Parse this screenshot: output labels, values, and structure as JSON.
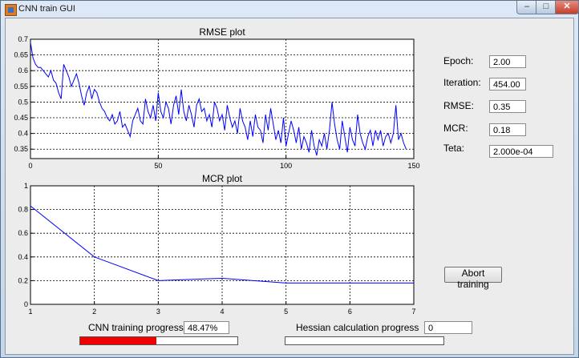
{
  "window": {
    "title": "CNN train GUI",
    "min_label": "–",
    "max_label": "□",
    "close_label": "✕"
  },
  "rmse_plot": {
    "title": "RMSE plot",
    "x_ticks": [
      "0",
      "50",
      "100",
      "150"
    ],
    "y_ticks": [
      "0.35",
      "0.4",
      "0.45",
      "0.5",
      "0.55",
      "0.6",
      "0.65",
      "0.7"
    ]
  },
  "mcr_plot": {
    "title": "MCR plot",
    "x_ticks": [
      "1",
      "2",
      "3",
      "4",
      "5",
      "6",
      "7"
    ],
    "y_ticks": [
      "0",
      "0.2",
      "0.4",
      "0.6",
      "0.8",
      "1"
    ]
  },
  "chart_data": [
    {
      "type": "line",
      "title": "RMSE plot",
      "xlim": [
        0,
        150
      ],
      "ylim": [
        0.32,
        0.7
      ],
      "grid": true,
      "color": "#0000ff",
      "x_step": 1,
      "values": [
        0.69,
        0.64,
        0.62,
        0.61,
        0.61,
        0.6,
        0.59,
        0.58,
        0.6,
        0.57,
        0.56,
        0.53,
        0.51,
        0.62,
        0.6,
        0.58,
        0.55,
        0.57,
        0.59,
        0.56,
        0.52,
        0.49,
        0.53,
        0.55,
        0.51,
        0.54,
        0.53,
        0.5,
        0.48,
        0.47,
        0.45,
        0.44,
        0.46,
        0.43,
        0.44,
        0.47,
        0.42,
        0.43,
        0.41,
        0.39,
        0.44,
        0.46,
        0.48,
        0.44,
        0.43,
        0.51,
        0.47,
        0.45,
        0.49,
        0.44,
        0.53,
        0.47,
        0.45,
        0.5,
        0.48,
        0.43,
        0.49,
        0.52,
        0.46,
        0.54,
        0.47,
        0.44,
        0.49,
        0.46,
        0.42,
        0.49,
        0.51,
        0.47,
        0.48,
        0.44,
        0.46,
        0.42,
        0.5,
        0.48,
        0.44,
        0.46,
        0.41,
        0.49,
        0.45,
        0.42,
        0.44,
        0.4,
        0.48,
        0.44,
        0.42,
        0.38,
        0.44,
        0.39,
        0.46,
        0.42,
        0.41,
        0.37,
        0.46,
        0.41,
        0.48,
        0.43,
        0.38,
        0.41,
        0.37,
        0.45,
        0.36,
        0.4,
        0.44,
        0.41,
        0.37,
        0.42,
        0.35,
        0.39,
        0.37,
        0.34,
        0.41,
        0.36,
        0.33,
        0.38,
        0.36,
        0.4,
        0.35,
        0.41,
        0.5,
        0.43,
        0.38,
        0.35,
        0.44,
        0.39,
        0.34,
        0.42,
        0.38,
        0.36,
        0.46,
        0.4,
        0.37,
        0.35,
        0.39,
        0.41,
        0.36,
        0.41,
        0.38,
        0.41,
        0.36,
        0.39,
        0.4,
        0.37,
        0.4,
        0.49,
        0.38,
        0.4,
        0.37,
        0.35
      ]
    },
    {
      "type": "line",
      "title": "MCR plot",
      "xlim": [
        1,
        7
      ],
      "ylim": [
        0,
        1
      ],
      "grid": true,
      "color": "#0000ff",
      "x": [
        1,
        2,
        3,
        4,
        5,
        6,
        7
      ],
      "values": [
        0.83,
        0.4,
        0.2,
        0.22,
        0.18,
        0.18,
        0.18
      ]
    }
  ],
  "stats": {
    "epoch_label": "Epoch:",
    "epoch_value": "2.00",
    "iteration_label": "Iteration:",
    "iteration_value": "454.00",
    "rmse_label": "RMSE:",
    "rmse_value": "0.35",
    "mcr_label": "MCR:",
    "mcr_value": "0.18",
    "teta_label": "Teta:",
    "teta_value": "2.000e-04"
  },
  "controls": {
    "abort_label": "Abort training"
  },
  "progress": {
    "cnn_label": "CNN training progress",
    "cnn_value": "48.47%",
    "cnn_fraction": 0.4847,
    "hessian_label": "Hessian calculation progress",
    "hessian_value": "0",
    "hessian_fraction": 0
  },
  "colors": {
    "line": "#0000ff",
    "progress_fill": "#f20000"
  }
}
